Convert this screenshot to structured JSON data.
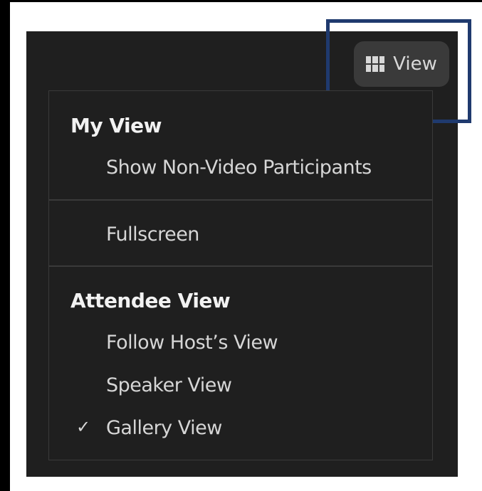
{
  "toolbar": {
    "view_button_label": "View"
  },
  "menu": {
    "my_view": {
      "title": "My View",
      "items": [
        "Show Non-Video Participants"
      ]
    },
    "fullscreen_label": "Fullscreen",
    "attendee_view": {
      "title": "Attendee View",
      "items": [
        "Follow Host’s View",
        "Speaker View",
        "Gallery View"
      ],
      "selected": "Gallery View"
    }
  },
  "icons": {
    "view_button": "grid-icon",
    "selected_marker": "check-icon"
  },
  "colors": {
    "panel_background": "#1f1f1f",
    "highlight_border": "#1f3a6e"
  }
}
